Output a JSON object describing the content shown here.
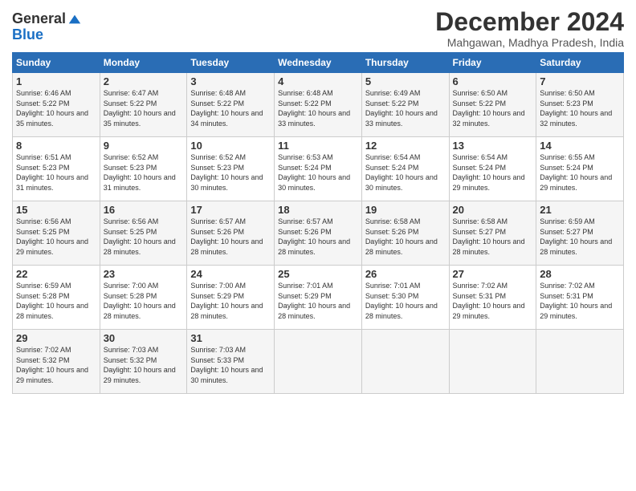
{
  "logo": {
    "line1": "General",
    "line2": "Blue"
  },
  "title": "December 2024",
  "location": "Mahgawan, Madhya Pradesh, India",
  "headers": [
    "Sunday",
    "Monday",
    "Tuesday",
    "Wednesday",
    "Thursday",
    "Friday",
    "Saturday"
  ],
  "weeks": [
    [
      {
        "day": "1",
        "rise": "6:46 AM",
        "set": "5:22 PM",
        "daylight": "10 hours and 35 minutes."
      },
      {
        "day": "2",
        "rise": "6:47 AM",
        "set": "5:22 PM",
        "daylight": "10 hours and 35 minutes."
      },
      {
        "day": "3",
        "rise": "6:48 AM",
        "set": "5:22 PM",
        "daylight": "10 hours and 34 minutes."
      },
      {
        "day": "4",
        "rise": "6:48 AM",
        "set": "5:22 PM",
        "daylight": "10 hours and 33 minutes."
      },
      {
        "day": "5",
        "rise": "6:49 AM",
        "set": "5:22 PM",
        "daylight": "10 hours and 33 minutes."
      },
      {
        "day": "6",
        "rise": "6:50 AM",
        "set": "5:22 PM",
        "daylight": "10 hours and 32 minutes."
      },
      {
        "day": "7",
        "rise": "6:50 AM",
        "set": "5:23 PM",
        "daylight": "10 hours and 32 minutes."
      }
    ],
    [
      {
        "day": "8",
        "rise": "6:51 AM",
        "set": "5:23 PM",
        "daylight": "10 hours and 31 minutes."
      },
      {
        "day": "9",
        "rise": "6:52 AM",
        "set": "5:23 PM",
        "daylight": "10 hours and 31 minutes."
      },
      {
        "day": "10",
        "rise": "6:52 AM",
        "set": "5:23 PM",
        "daylight": "10 hours and 30 minutes."
      },
      {
        "day": "11",
        "rise": "6:53 AM",
        "set": "5:24 PM",
        "daylight": "10 hours and 30 minutes."
      },
      {
        "day": "12",
        "rise": "6:54 AM",
        "set": "5:24 PM",
        "daylight": "10 hours and 30 minutes."
      },
      {
        "day": "13",
        "rise": "6:54 AM",
        "set": "5:24 PM",
        "daylight": "10 hours and 29 minutes."
      },
      {
        "day": "14",
        "rise": "6:55 AM",
        "set": "5:24 PM",
        "daylight": "10 hours and 29 minutes."
      }
    ],
    [
      {
        "day": "15",
        "rise": "6:56 AM",
        "set": "5:25 PM",
        "daylight": "10 hours and 29 minutes."
      },
      {
        "day": "16",
        "rise": "6:56 AM",
        "set": "5:25 PM",
        "daylight": "10 hours and 28 minutes."
      },
      {
        "day": "17",
        "rise": "6:57 AM",
        "set": "5:26 PM",
        "daylight": "10 hours and 28 minutes."
      },
      {
        "day": "18",
        "rise": "6:57 AM",
        "set": "5:26 PM",
        "daylight": "10 hours and 28 minutes."
      },
      {
        "day": "19",
        "rise": "6:58 AM",
        "set": "5:26 PM",
        "daylight": "10 hours and 28 minutes."
      },
      {
        "day": "20",
        "rise": "6:58 AM",
        "set": "5:27 PM",
        "daylight": "10 hours and 28 minutes."
      },
      {
        "day": "21",
        "rise": "6:59 AM",
        "set": "5:27 PM",
        "daylight": "10 hours and 28 minutes."
      }
    ],
    [
      {
        "day": "22",
        "rise": "6:59 AM",
        "set": "5:28 PM",
        "daylight": "10 hours and 28 minutes."
      },
      {
        "day": "23",
        "rise": "7:00 AM",
        "set": "5:28 PM",
        "daylight": "10 hours and 28 minutes."
      },
      {
        "day": "24",
        "rise": "7:00 AM",
        "set": "5:29 PM",
        "daylight": "10 hours and 28 minutes."
      },
      {
        "day": "25",
        "rise": "7:01 AM",
        "set": "5:29 PM",
        "daylight": "10 hours and 28 minutes."
      },
      {
        "day": "26",
        "rise": "7:01 AM",
        "set": "5:30 PM",
        "daylight": "10 hours and 28 minutes."
      },
      {
        "day": "27",
        "rise": "7:02 AM",
        "set": "5:31 PM",
        "daylight": "10 hours and 29 minutes."
      },
      {
        "day": "28",
        "rise": "7:02 AM",
        "set": "5:31 PM",
        "daylight": "10 hours and 29 minutes."
      }
    ],
    [
      {
        "day": "29",
        "rise": "7:02 AM",
        "set": "5:32 PM",
        "daylight": "10 hours and 29 minutes."
      },
      {
        "day": "30",
        "rise": "7:03 AM",
        "set": "5:32 PM",
        "daylight": "10 hours and 29 minutes."
      },
      {
        "day": "31",
        "rise": "7:03 AM",
        "set": "5:33 PM",
        "daylight": "10 hours and 30 minutes."
      },
      null,
      null,
      null,
      null
    ]
  ]
}
